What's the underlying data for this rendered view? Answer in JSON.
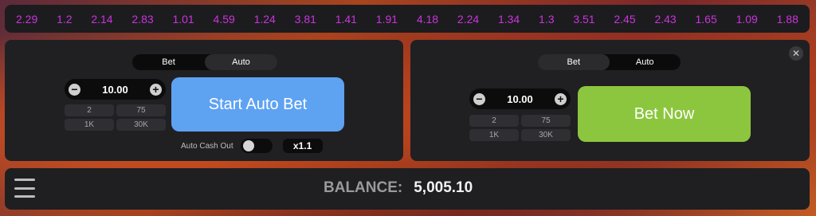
{
  "history": [
    "2.29",
    "1.2",
    "2.14",
    "2.83",
    "1.01",
    "4.59",
    "1.24",
    "3.81",
    "1.41",
    "1.91",
    "4.18",
    "2.24",
    "1.34",
    "1.3",
    "3.51",
    "2.45",
    "2.43",
    "1.65",
    "1.09",
    "1.88"
  ],
  "colors": {
    "history_text": "#cc33dd",
    "auto_bet_button": "#5ea2f2",
    "bet_now_button": "#8cc63e"
  },
  "left_panel": {
    "tabs": [
      "Bet",
      "Auto"
    ],
    "active_tab": "Auto",
    "amount": "10.00",
    "chips": [
      "2",
      "75",
      "1K",
      "30K"
    ],
    "action_label": "Start Auto Bet",
    "auto_cash_out_label": "Auto Cash Out",
    "auto_cash_out_enabled": false,
    "multiplier": "x1.1"
  },
  "right_panel": {
    "tabs": [
      "Bet",
      "Auto"
    ],
    "active_tab": "Bet",
    "amount": "10.00",
    "chips": [
      "2",
      "75",
      "1K",
      "30K"
    ],
    "action_label": "Bet Now",
    "close_icon": "close-icon"
  },
  "footer": {
    "menu_icon": "hamburger-menu-icon",
    "balance_label": "BALANCE:",
    "balance_value": "5,005.10"
  }
}
